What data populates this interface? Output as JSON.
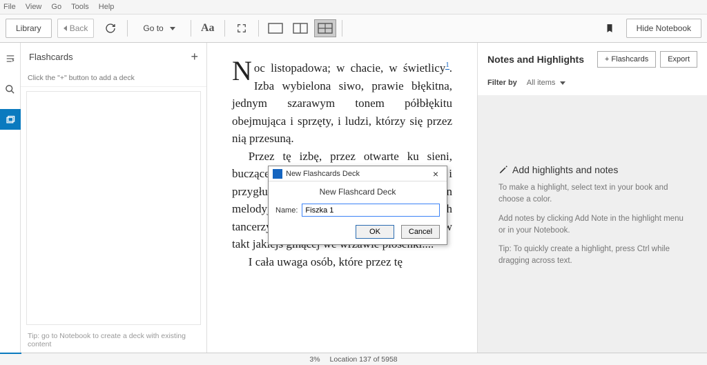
{
  "menubar": {
    "file": "File",
    "view": "View",
    "go": "Go",
    "tools": "Tools",
    "help": "Help"
  },
  "toolbar": {
    "library": "Library",
    "back": "Back",
    "goto": "Go to",
    "hide_notebook": "Hide Notebook"
  },
  "flashcards": {
    "title": "Flashcards",
    "hint": "Click the \"+\" button to add a deck",
    "tip": "Tip: go to Notebook to create a deck with existing content"
  },
  "reader": {
    "para1_drop": "N",
    "para1": "oc listopadowa; w chacie, w świetlicy",
    "para1_fn": "1",
    "para1b": ". Izba wybielona siwo, prawie błękitna, jednym szarawym tonem półbłękitu obejmująca i sprzęty, i ludzi, którzy się przez nią przesuną.",
    "para2": "Przez tę izbę, przez otwarte ku sieni, buczącego wrzaskiem niesfornego ludu i bab i przygłuszający wszystką nutę jeden melodyjny szum i rumot tupotających tancerzy, co się tam kręcą w zbitej masie w takt jakiejś ginącej we wrzawie piosenki....",
    "para3": "I cała uwaga osób, które przez tę"
  },
  "dialog": {
    "window_title": "New Flashcards Deck",
    "heading": "New Flashcard Deck",
    "name_label": "Name:",
    "name_value": "Fiszka 1",
    "ok": "OK",
    "cancel": "Cancel"
  },
  "notes": {
    "title": "Notes and Highlights",
    "flashcards_btn": "+ Flashcards",
    "export_btn": "Export",
    "filter_label": "Filter by",
    "filter_value": "All items",
    "heading": "Add highlights and notes",
    "p1": "To make a highlight, select text in your book and choose a color.",
    "p2": "Add notes by clicking Add Note in the highlight menu or in your Notebook.",
    "p3": "Tip: To quickly create a highlight, press Ctrl while dragging across text."
  },
  "status": {
    "percent": "3%",
    "location": "Location 137 of 5958"
  }
}
